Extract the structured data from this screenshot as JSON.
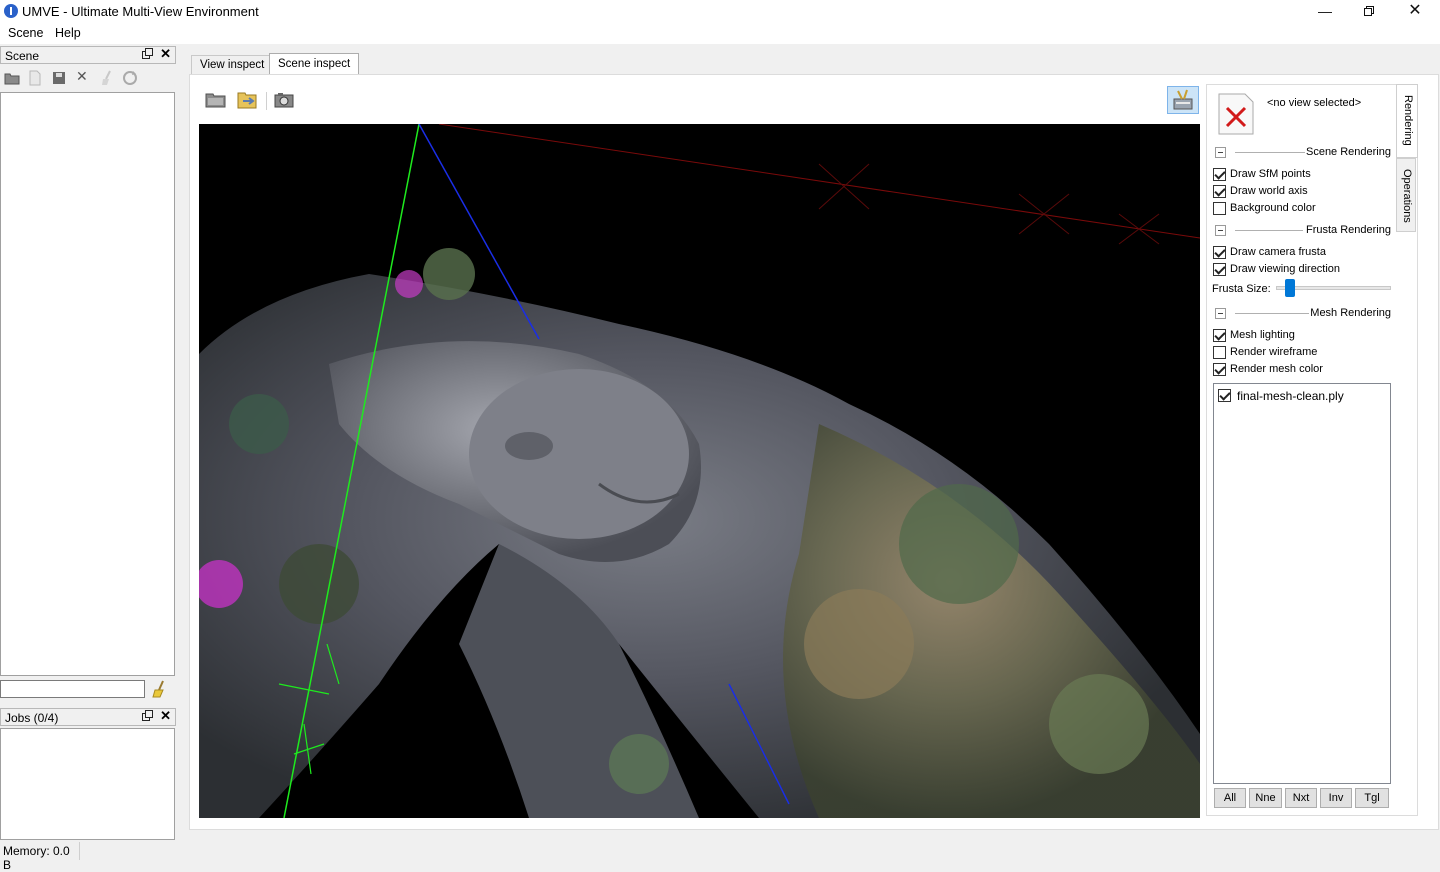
{
  "window": {
    "title": "UMVE - Ultimate Multi-View Environment",
    "controls": [
      "minimize-icon",
      "restore-icon",
      "close-icon"
    ]
  },
  "menu": {
    "items": [
      "Scene",
      "Help"
    ]
  },
  "scene_dock": {
    "title": "Scene",
    "toolbar_icons": [
      "open-folder-icon",
      "new-file-icon",
      "save-icon",
      "delete-icon",
      "clean-icon",
      "refresh-icon"
    ],
    "filter_value": "",
    "clear_icon": "broom-icon"
  },
  "jobs_dock": {
    "title": "Jobs (0/4)"
  },
  "status": {
    "memory": "Memory: 0.0 B"
  },
  "tabs": [
    {
      "label": "View inspect",
      "active": false
    },
    {
      "label": "Scene inspect",
      "active": true
    }
  ],
  "scene_toolbar": {
    "icons": [
      "open-scene-icon",
      "reload-icon",
      "screenshot-icon"
    ],
    "right_icon": "settings-toolbox-icon"
  },
  "right_panel": {
    "view_label": "<no view selected>",
    "side_tabs": [
      "Rendering",
      "Operations"
    ],
    "sections": {
      "scene": {
        "label": "Scene Rendering",
        "options": [
          {
            "label": "Draw SfM points",
            "checked": true
          },
          {
            "label": "Draw world axis",
            "checked": true
          },
          {
            "label": "Background color",
            "checked": false
          }
        ]
      },
      "frusta": {
        "label": "Frusta Rendering",
        "options": [
          {
            "label": "Draw camera frusta",
            "checked": true
          },
          {
            "label": "Draw viewing direction",
            "checked": true
          }
        ],
        "size_label": "Frusta Size:",
        "size_value": 0.08
      },
      "mesh": {
        "label": "Mesh Rendering",
        "options": [
          {
            "label": "Mesh lighting",
            "checked": true
          },
          {
            "label": "Render wireframe",
            "checked": false
          },
          {
            "label": "Render mesh color",
            "checked": true
          }
        ]
      }
    },
    "mesh_list": [
      {
        "label": "final-mesh-clean.ply",
        "checked": true
      }
    ],
    "list_buttons": [
      "All",
      "Nne",
      "Nxt",
      "Inv",
      "Tgl"
    ]
  },
  "colors": {
    "accent": "#0078d7",
    "viewport_bg": "#000000",
    "axis_x": "#7a0a0a",
    "axis_y": "#1eeb1e",
    "axis_z": "#1a2ee6"
  }
}
